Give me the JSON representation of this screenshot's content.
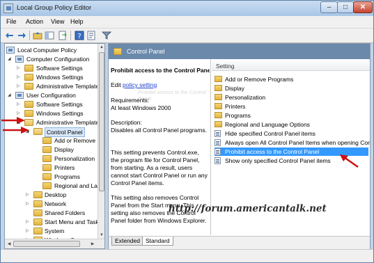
{
  "window": {
    "title": "Local Group Policy Editor"
  },
  "title_controls": {
    "minimize": "–",
    "maximize": "□",
    "close": "✕"
  },
  "menu": [
    "File",
    "Action",
    "View",
    "Help"
  ],
  "toolbar": {
    "icons": [
      "back-icon",
      "forward-icon",
      "up-folder-icon",
      "show-hide-tree-icon",
      "export-list-icon",
      "help-icon",
      "properties-icon",
      "filter-icon"
    ]
  },
  "tree": {
    "items": [
      {
        "label": "Local Computer Policy"
      },
      {
        "label": "Computer Configuration"
      },
      {
        "label": "Software Settings"
      },
      {
        "label": "Windows Settings"
      },
      {
        "label": "Administrative Template"
      },
      {
        "label": "User Configuration"
      },
      {
        "label": "Software Settings"
      },
      {
        "label": "Windows Settings"
      },
      {
        "label": "Administrative Template"
      },
      {
        "label": "Control Panel"
      },
      {
        "label": "Add or Remove P"
      },
      {
        "label": "Display"
      },
      {
        "label": "Personalization"
      },
      {
        "label": "Printers"
      },
      {
        "label": "Programs"
      },
      {
        "label": "Regional and Lan"
      },
      {
        "label": "Desktop"
      },
      {
        "label": "Network"
      },
      {
        "label": "Shared Folders"
      },
      {
        "label": "Start Menu and Taskb"
      },
      {
        "label": "System"
      },
      {
        "label": "Windows Componer"
      }
    ]
  },
  "detail": {
    "header": "Control Panel",
    "description": {
      "title": "Prohibit access to the Control Panel",
      "edit_prefix": "Edit",
      "edit_link": "policy setting",
      "ghost_text": "Prohibit access to the Control Panel",
      "requirements_label": "Requirements:",
      "requirements_value": "At least Windows 2000",
      "description_label": "Description:",
      "description_text": "Disables all Control Panel programs.",
      "para1": "This setting prevents Control.exe, the program file for Control Panel, from starting. As a result, users cannot start Control Panel or run any Control Panel items.",
      "para2": "This setting also removes Control Panel from the Start menu. This setting also removes the Control Panel folder from Windows Explorer."
    },
    "list_header": "Setting",
    "list": [
      {
        "type": "folder",
        "label": "Add or Remove Programs"
      },
      {
        "type": "folder",
        "label": "Display"
      },
      {
        "type": "folder",
        "label": "Personalization"
      },
      {
        "type": "folder",
        "label": "Printers"
      },
      {
        "type": "folder",
        "label": "Programs"
      },
      {
        "type": "folder",
        "label": "Regional and Language Options"
      },
      {
        "type": "setting",
        "label": "Hide specified Control Panel items"
      },
      {
        "type": "setting",
        "label": "Always open All Control Panel Items when opening Cont"
      },
      {
        "type": "setting",
        "label": "Prohibit access to the Control Panel",
        "selected": true
      },
      {
        "type": "setting",
        "label": "Show only specified Control Panel items"
      }
    ],
    "tabs": [
      "Extended",
      "Standard"
    ],
    "active_tab": "Standard"
  },
  "watermark": "http://forum.americantalk.net",
  "colors": {
    "annotation_arrow": "#cc1111",
    "selection": "#3399ff",
    "header_bar": "#6b89ab"
  }
}
